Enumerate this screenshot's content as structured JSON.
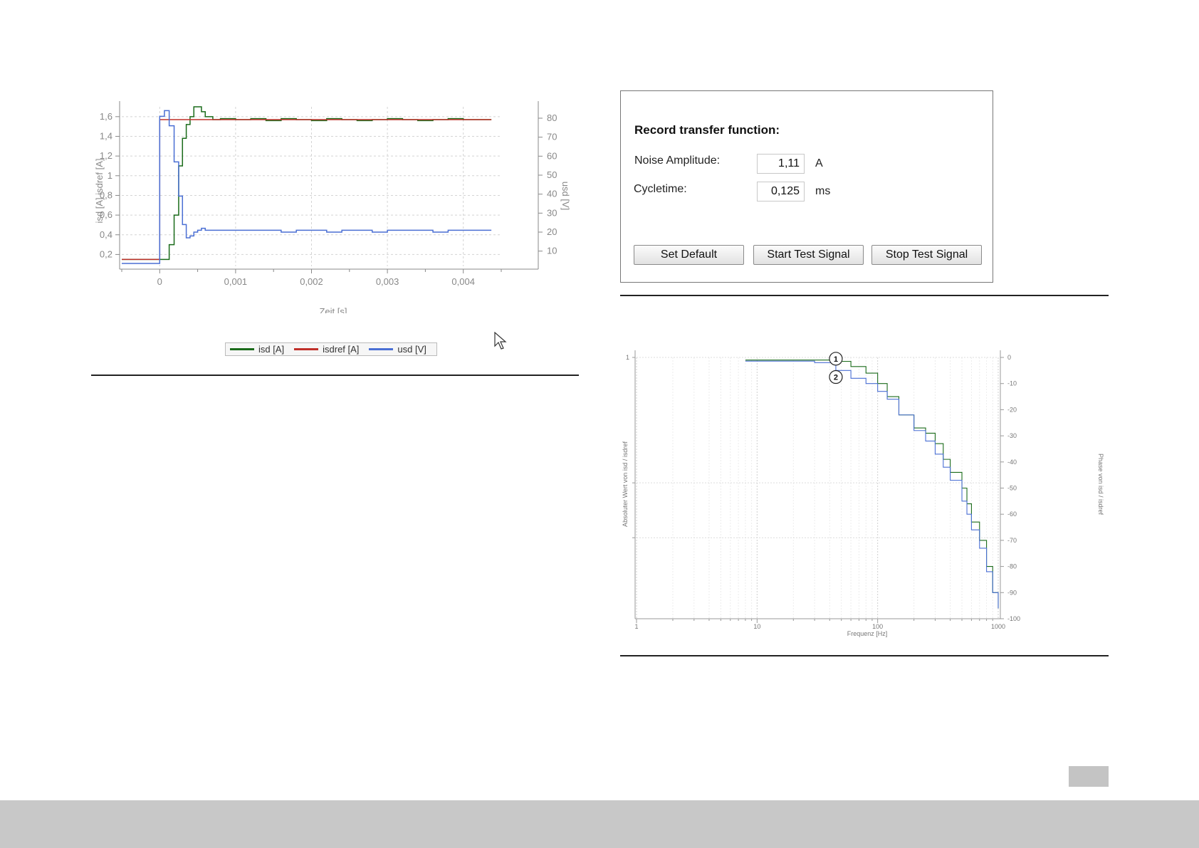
{
  "step_response": {
    "y_left_label": "isd [A]  isdref [A]",
    "y_right_label": "usd [V]",
    "x_label": "Zeit [s]",
    "x_ticks": [
      "0",
      "0,001",
      "0,002",
      "0,003",
      "0,004"
    ],
    "y_left_ticks": [
      "0,2",
      "0,4",
      "0,6",
      "0,8",
      "1",
      "1,2",
      "1,4",
      "1,6"
    ],
    "y_right_ticks": [
      "10",
      "20",
      "30",
      "40",
      "50",
      "60",
      "70",
      "80"
    ],
    "legend": [
      {
        "label": "isd [A]",
        "color": "#1a6b1a"
      },
      {
        "label": "isdref [A]",
        "color": "#c0302a"
      },
      {
        "label": "usd [V]",
        "color": "#4a6fd4"
      }
    ]
  },
  "transfer_panel": {
    "title": "Record transfer function:",
    "noise_label": "Noise Amplitude:",
    "noise_value": "1,11",
    "noise_unit": "A",
    "cycle_label": "Cycletime:",
    "cycle_value": "0,125",
    "cycle_unit": "ms",
    "buttons": {
      "set_default": "Set Default",
      "start": "Start Test Signal",
      "stop": "Stop Test Signal"
    }
  },
  "bode": {
    "x_label": "Frequenz [Hz]",
    "y_left_label": "Absoluter Wert von isd / isdref",
    "y_right_label": "Phase von isd / isdref",
    "x_ticks": [
      "1",
      "10",
      "100",
      "1000"
    ],
    "y_left_ticks": [
      "1"
    ],
    "y_right_ticks": [
      "0",
      "-10",
      "-20",
      "-30",
      "-40",
      "-50",
      "-60",
      "-70",
      "-80",
      "-90",
      "-100"
    ],
    "markers": [
      "1",
      "2"
    ]
  },
  "chart_data": [
    {
      "type": "line",
      "x_label": "Zeit [s]",
      "y_label": "isd [A]  isdref [A]",
      "y2_label": "usd [V]",
      "xlim": [
        -0.0005,
        0.0045
      ],
      "ylim": [
        0.08,
        1.7
      ],
      "y2lim": [
        2,
        86
      ],
      "step": true,
      "series": [
        {
          "name": "isd [A]",
          "axis": "left",
          "color": "#1a6b1a",
          "x": [
            -0.0005,
            -0.0004,
            -0.0003,
            -0.0002,
            -0.0001,
            0.0,
            0.000125,
            0.00019,
            0.00025,
            0.0003,
            0.00035,
            0.0004,
            0.00045,
            0.0005,
            0.00055,
            0.0006,
            0.0007,
            0.0008,
            0.001,
            0.0012,
            0.0014,
            0.0016,
            0.0018,
            0.002,
            0.0022,
            0.0024,
            0.0026,
            0.0028,
            0.003,
            0.0032,
            0.0034,
            0.0036,
            0.0038,
            0.004,
            0.0042,
            0.00437
          ],
          "y": [
            0.15,
            0.15,
            0.15,
            0.15,
            0.15,
            0.15,
            0.3,
            0.6,
            1.1,
            1.38,
            1.52,
            1.6,
            1.7,
            1.7,
            1.65,
            1.6,
            1.57,
            1.58,
            1.57,
            1.58,
            1.56,
            1.58,
            1.57,
            1.56,
            1.58,
            1.57,
            1.56,
            1.57,
            1.58,
            1.57,
            1.56,
            1.57,
            1.58,
            1.57,
            1.57,
            1.57
          ]
        },
        {
          "name": "isdref [A]",
          "axis": "left",
          "color": "#c0302a",
          "x": [
            -0.0005,
            0.0,
            0.0,
            0.00437
          ],
          "y": [
            0.15,
            0.15,
            1.57,
            1.57
          ]
        },
        {
          "name": "usd [V]",
          "axis": "right",
          "color": "#4a6fd4",
          "x": [
            -0.0005,
            -0.0002,
            0.0,
            6.2e-05,
            0.000125,
            0.00019,
            0.00025,
            0.0003,
            0.00035,
            0.0004,
            0.00045,
            0.0005,
            0.00055,
            0.0006,
            0.0007,
            0.0008,
            0.001,
            0.0012,
            0.0014,
            0.0016,
            0.0018,
            0.002,
            0.0022,
            0.0024,
            0.0026,
            0.0028,
            0.003,
            0.0032,
            0.0034,
            0.0036,
            0.0038,
            0.004,
            0.0042,
            0.00437
          ],
          "y": [
            3.5,
            3.5,
            81,
            84,
            76,
            57,
            39,
            24,
            17,
            18,
            20,
            21,
            22,
            21,
            21,
            21,
            21,
            21,
            21,
            20,
            21,
            21,
            20,
            21,
            21,
            20,
            21,
            21,
            21,
            20,
            21,
            21,
            21,
            21
          ]
        }
      ]
    },
    {
      "type": "line",
      "x_label": "Frequenz [Hz]",
      "y_label": "Absoluter Wert von isd / isdref",
      "y2_label": "Phase von isd / isdref",
      "x_scale": "log",
      "xlim": [
        1,
        1000
      ],
      "y2lim": [
        -100,
        0
      ],
      "series": [
        {
          "label": "1",
          "axis": "left",
          "color": "#1a6b1a",
          "x": [
            8,
            15,
            30,
            45,
            60,
            80,
            100,
            120,
            150,
            200,
            250,
            300,
            350,
            400,
            500,
            550,
            600,
            700,
            800,
            900,
            1000
          ],
          "y_rel": [
            0.01,
            0.01,
            0.01,
            0.015,
            0.035,
            0.06,
            0.1,
            0.15,
            0.22,
            0.27,
            0.29,
            0.33,
            0.39,
            0.44,
            0.5,
            0.56,
            0.63,
            0.7,
            0.8,
            0.9,
            0.96
          ]
        }
      ]
    }
  ]
}
